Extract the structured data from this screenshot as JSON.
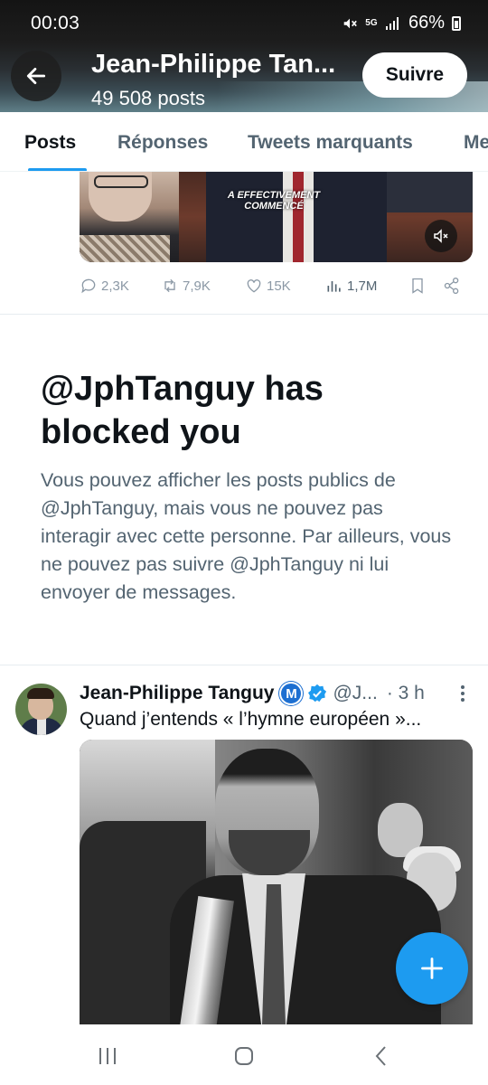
{
  "status_bar": {
    "time": "00:03",
    "network": "5G",
    "battery": "66%"
  },
  "header": {
    "title": "Jean-Philippe Tan...",
    "post_count": "49 508 posts",
    "follow_label": "Suivre"
  },
  "tabs": [
    {
      "label": "Posts",
      "active": true
    },
    {
      "label": "Réponses",
      "active": false
    },
    {
      "label": "Tweets marquants",
      "active": false
    },
    {
      "label": "Me",
      "active": false
    }
  ],
  "media_top": {
    "caption": "A EFFECTIVEMENT COMMENCÉ"
  },
  "actions": {
    "replies": "2,3K",
    "reposts": "7,9K",
    "likes": "15K",
    "views": "1,7M"
  },
  "blocked": {
    "title": "@JphTanguy has blocked you",
    "body": "Vous pouvez afficher les posts publics de @JphTanguy, mais vous ne pouvez pas interagir avec cette personne. Par ailleurs, vous ne pouvez pas suivre @JphTanguy ni lui envoyer de messages."
  },
  "post": {
    "author": "Jean-Philippe Tanguy",
    "badge_letter": "M",
    "handle": "@J...",
    "time": "· 3 h",
    "text": "Quand j’entends « l’hymne européen »..."
  },
  "colors": {
    "accent": "#1d9bf0",
    "text_primary": "#0f1419",
    "text_secondary": "#536471",
    "party_badge": "#1d6fd1"
  },
  "icons": [
    "back-arrow-icon",
    "mute-icon",
    "signal-icon",
    "battery-icon",
    "reply-icon",
    "repost-icon",
    "like-icon",
    "views-icon",
    "bookmark-icon",
    "share-icon",
    "verified-icon",
    "more-icon",
    "plus-icon",
    "recents-icon",
    "home-icon",
    "back-icon"
  ]
}
